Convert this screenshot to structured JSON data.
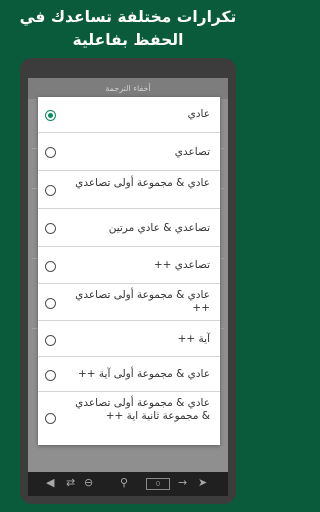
{
  "headline": "تكرارات مختلفة تساعدك في الحفظ بفاعلية",
  "screen": {
    "appbar_title": "أخفاء الترجمة"
  },
  "dialog": {
    "selected_index": 0,
    "options": [
      {
        "label": "عادي"
      },
      {
        "label": "تصاعدي"
      },
      {
        "label": "عادي & مجموعة أولى تصاعدي"
      },
      {
        "label": "تصاعدي & عادي مرتين"
      },
      {
        "label": "تصاعدي ++"
      },
      {
        "label": "عادي & مجموعة أولى تصاعدي ++"
      },
      {
        "label": "آية ++"
      },
      {
        "label": "عادي & مجموعة أولى آية ++"
      },
      {
        "label": "عادي & مجموعة أولى تصاعدي & مجموعة ثانية اية ++"
      }
    ]
  },
  "navbar": {
    "counter": "0",
    "icons": [
      "volume-icon",
      "repeat-icon",
      "minus-circle-icon",
      "search-icon",
      "forward-arrow-icon",
      "send-icon"
    ]
  },
  "colors": {
    "background": "#0a5a3c",
    "accent": "#0a8c5c",
    "dialog": "#ffffff"
  }
}
